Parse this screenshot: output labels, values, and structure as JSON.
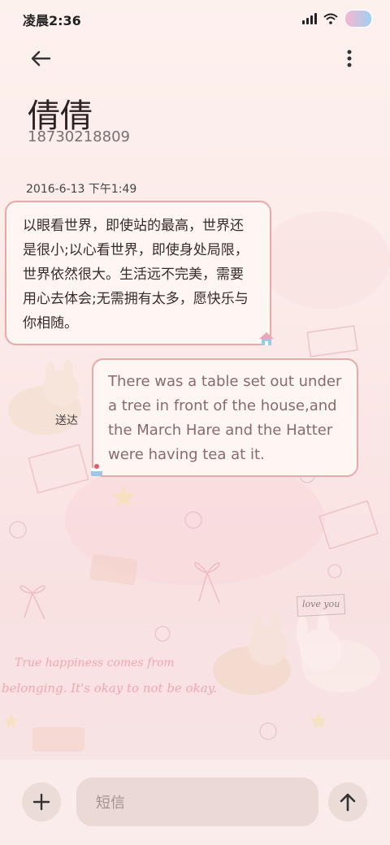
{
  "status_bar": {
    "time": "凌晨2:36"
  },
  "contact": {
    "name": "倩倩",
    "number": "18730218809"
  },
  "conversation": {
    "timestamp": "2016-6-13 下午1:49",
    "incoming_message": "以眼看世界，即使站的最高，世界还是很小;以心看世界，即使身处局限，世界依然很大。生活远不完美，需要用心去体会;无需拥有太多，愿快乐与你相随。",
    "outgoing_message": "There was a table set out under a tree in front of the house,and the March Hare and the Hatter were having tea at it.",
    "sent_status": "送达"
  },
  "wallpaper_text": {
    "line1": "True happiness comes from",
    "line2": "belonging. It's okay to not be okay.",
    "note": "love you"
  },
  "composer": {
    "placeholder": "短信"
  },
  "icons": {
    "back": "arrow-left-icon",
    "more": "more-vertical-icon",
    "add": "plus-icon",
    "send": "arrow-up-icon"
  },
  "colors": {
    "bubble_border": "#e9a8a9",
    "bubble_bg": "#fdf6f2",
    "accent_text": "#f1a6b0"
  }
}
